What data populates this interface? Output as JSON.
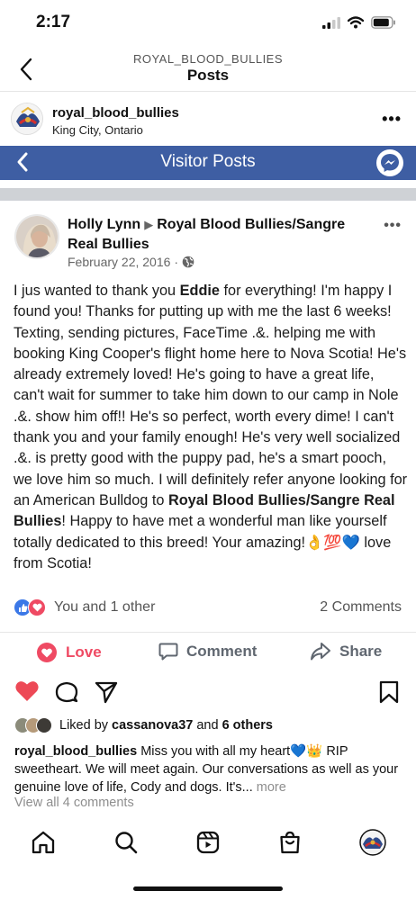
{
  "status_bar": {
    "time": "2:17"
  },
  "header": {
    "subtitle": "ROYAL_BLOOD_BULLIES",
    "title": "Posts"
  },
  "account": {
    "username": "royal_blood_bullies",
    "location": "King City, Ontario"
  },
  "screenshot_bar": {
    "title": "Visitor Posts",
    "bg_color": "#3e5ea3"
  },
  "post": {
    "author": "Holly Lynn",
    "page_name": "Royal Blood Bullies/Sangre Real Bullies",
    "date": "February 22, 2016",
    "body_1": "I jus wanted to thank you ",
    "body_bold_1": "Eddie",
    "body_2": " for everything! I'm happy I found you! Thanks for putting up with me the last 6 weeks! Texting, sending pictures, FaceTime .&. helping me with booking King Cooper's flight home here to Nova Scotia! He's already extremely loved! He's going to have a great life, can't wait for summer to take him down to our camp in Nole .&. show him off!! He's so perfect, worth every dime! I can't thank you and your family enough! He's very well socialized .&. is pretty good with the puppy pad, he's a smart pooch, we love him so much. I will definitely refer anyone looking for an American Bulldog to ",
    "body_bold_2": "Royal Blood Bullies/Sangre Real Bullies",
    "body_3": "! Happy to have met a wonderful man like yourself totally dedicated to this breed! Your amazing!",
    "body_emojis": "👌💯💙",
    "body_4": " love from Scotia!",
    "reactions_text": "You and 1 other",
    "comments_count": "2 Comments",
    "actions": {
      "love": "Love",
      "comment": "Comment",
      "share": "Share"
    },
    "colors": {
      "love": "#ef4a63",
      "like": "#3b78e7"
    }
  },
  "instagram": {
    "liked_prefix": "Liked by ",
    "liked_user": "cassanova37",
    "liked_mid": " and ",
    "liked_others": "6 others",
    "caption_user": "royal_blood_bullies",
    "caption_text": " Miss you with all my heart💙👑 RIP sweetheart. We will meet again. Our conversations as well as your genuine love of life, Cody and  dogs. It's...",
    "caption_more": " more",
    "view_comments": "View all 4 comments",
    "heart_color": "#ed4956"
  }
}
